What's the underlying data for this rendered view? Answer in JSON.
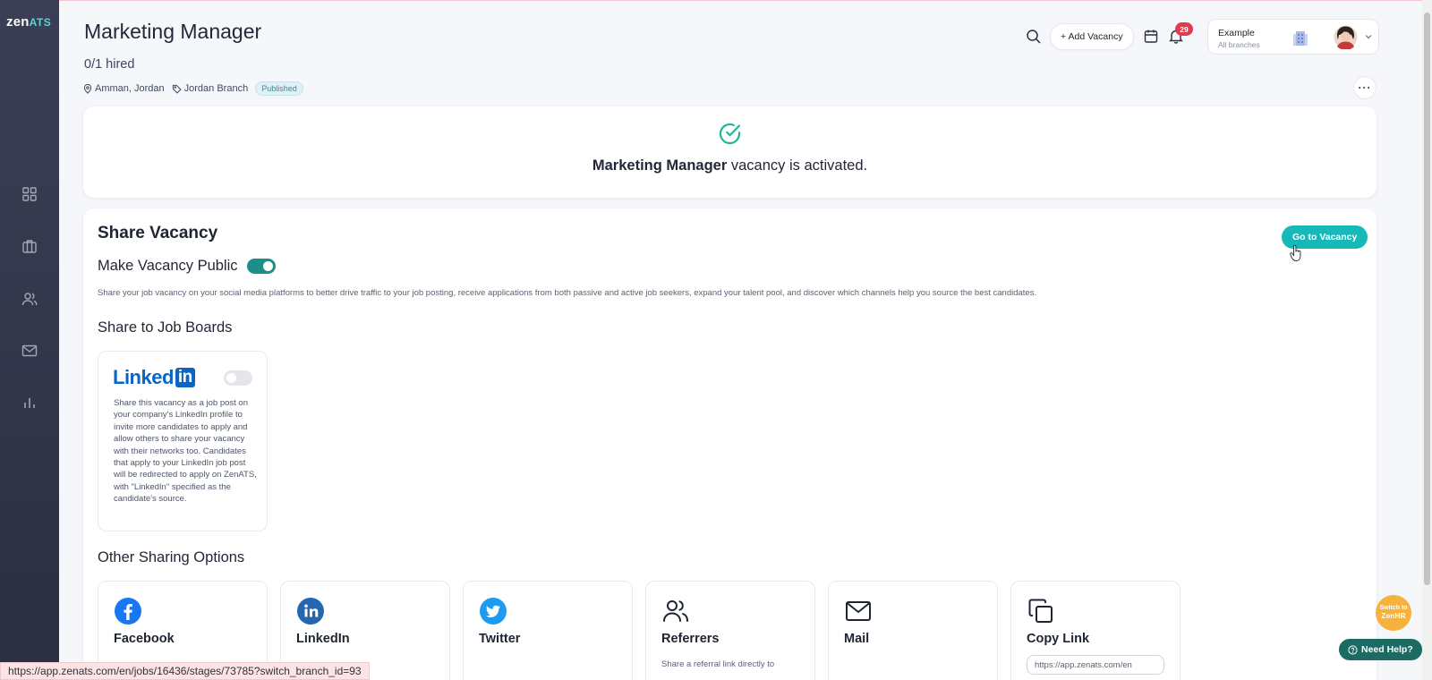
{
  "app": {
    "logo_main": "zen",
    "logo_sub": "ATS"
  },
  "sidebar": {
    "items": [
      {
        "icon": "dashboard-grid-icon"
      },
      {
        "icon": "briefcase-icon"
      },
      {
        "icon": "users-icon"
      },
      {
        "icon": "mail-icon"
      },
      {
        "icon": "bar-chart-icon"
      }
    ]
  },
  "header": {
    "title": "Marketing Manager",
    "hired": "0/1 hired",
    "location": "Amman, Jordan",
    "branch": "Jordan Branch",
    "status": "Published"
  },
  "topbar": {
    "add_vacancy_label": "+ Add Vacancy",
    "notifications_count": "29",
    "company_name": "Example",
    "company_sub": "All branches"
  },
  "activation": {
    "bold": "Marketing Manager",
    "text": " vacancy is activated."
  },
  "share": {
    "title": "Share Vacancy",
    "go_to_label": "Go to Vacancy",
    "make_public_label": "Make Vacancy Public",
    "make_public_on": true,
    "description": "Share your job vacancy on your social media platforms to better drive traffic to your job posting, receive applications from both passive and active job seekers, expand your talent pool, and discover which channels help you source the best candidates.",
    "job_boards_title": "Share to Job Boards",
    "linkedin_logo_text": "Linked",
    "linkedin_logo_in": "in",
    "linkedin_on": false,
    "linkedin_desc": "Share this vacancy as a job post on your company's LinkedIn profile to invite more candidates to apply and allow others to share your vacancy with their networks too. Candidates that apply to your LinkedIn job post will be redirected to apply on ZenATS, with \"LinkedIn\" specified as the candidate's source.",
    "other_title": "Other Sharing Options",
    "options": [
      {
        "label": "Facebook",
        "icon": "facebook-icon",
        "desc": ""
      },
      {
        "label": "LinkedIn",
        "icon": "linkedin-icon",
        "desc": ""
      },
      {
        "label": "Twitter",
        "icon": "twitter-icon",
        "desc": ""
      },
      {
        "label": "Referrers",
        "icon": "users-icon",
        "desc": "Share a referral link directly to"
      },
      {
        "label": "Mail",
        "icon": "mail-icon",
        "desc": ""
      },
      {
        "label": "Copy Link",
        "icon": "copy-icon",
        "desc": ""
      }
    ],
    "copy_link_value": "https://app.zenats.com/en"
  },
  "floating": {
    "switch_label_line1": "Switch to",
    "switch_label_line2": "ZenHR",
    "need_help_label": "Need Help?"
  },
  "status_bar": {
    "url": "https://app.zenats.com/en/jobs/16436/stages/73785?switch_branch_id=93"
  },
  "colors": {
    "accent": "#17b8b8",
    "toggle_on": "#1d8f8a",
    "linkedin": "#0a66c2",
    "facebook": "#1877f2",
    "twitter": "#1d9bf0",
    "badge_red": "#e23a4e",
    "sidebar": "#32364a"
  }
}
